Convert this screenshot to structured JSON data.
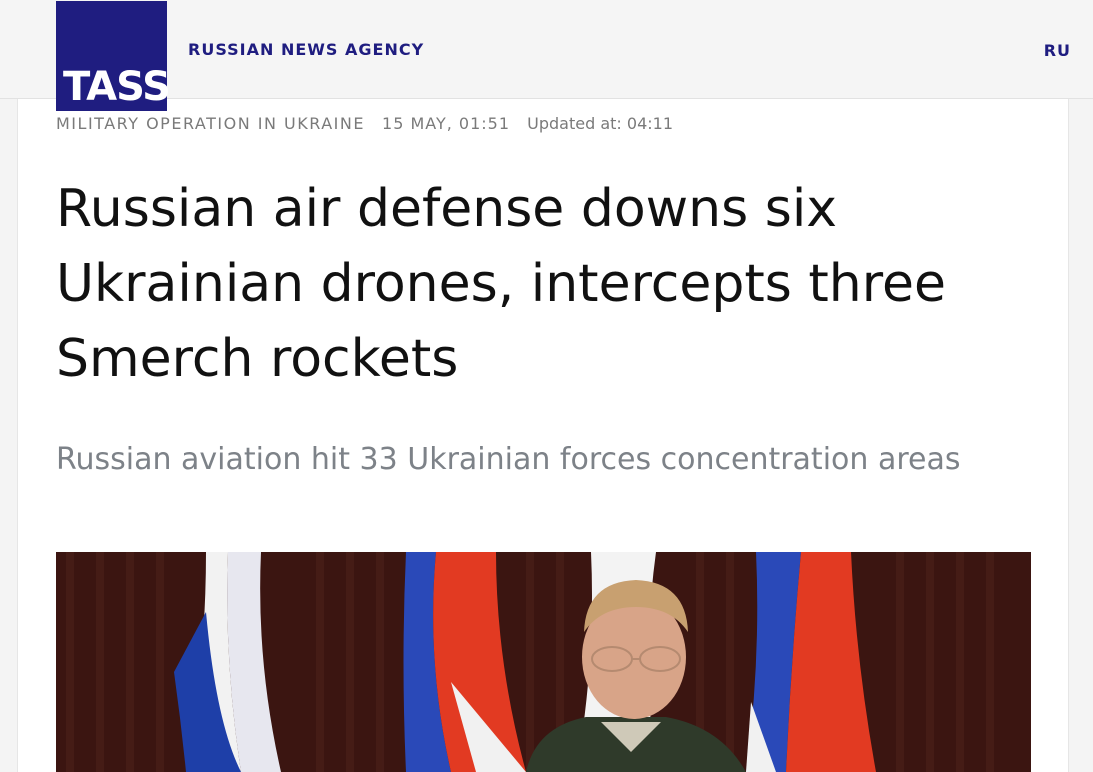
{
  "header": {
    "logo_text": "TASS",
    "agency_name": "RUSSIAN NEWS AGENCY",
    "language_link": "RU"
  },
  "article": {
    "category": "MILITARY OPERATION IN UKRAINE",
    "date": "15 MAY, 01:51",
    "updated": "Updated at: 04:11",
    "headline": "Russian air defense downs six Ukrainian drones, intercepts three Smerch rockets",
    "lead": "Russian aviation hit 33 Ukrainian forces concentration areas"
  },
  "colors": {
    "brand": "#1f1d80",
    "headline": "#111111",
    "lead": "#7d8288",
    "meta": "#7a7a7a"
  },
  "icons": [
    "tass-logo",
    "article-photo"
  ]
}
